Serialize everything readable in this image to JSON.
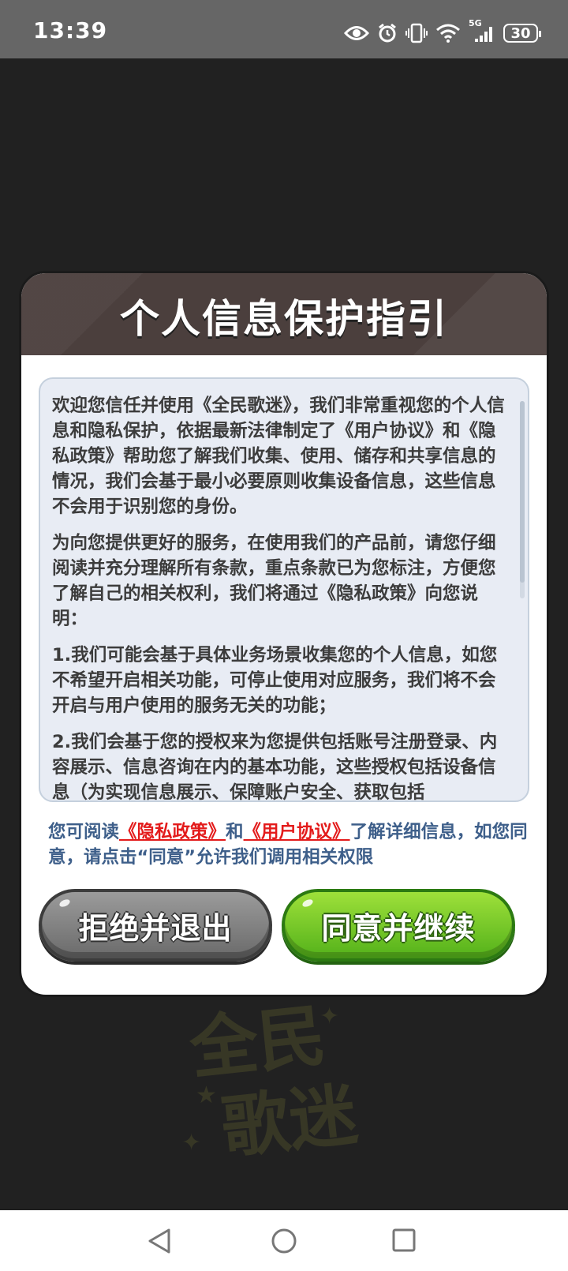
{
  "status_bar": {
    "time": "13:39",
    "battery_level": "30",
    "network_label": "5G",
    "icons": [
      "eye-icon",
      "alarm-icon",
      "vibrate-icon",
      "wifi-icon",
      "signal-icon",
      "battery-icon"
    ]
  },
  "background": {
    "logo_line1": "全民",
    "logo_line2": "歌迷"
  },
  "dialog": {
    "title": "个人信息保护指引",
    "paragraphs": [
      "欢迎您信任并使用《全民歌迷》，我们非常重视您的个人信息和隐私保护，依据最新法律制定了《用户协议》和《隐私政策》帮助您了解我们收集、使用、储存和共享信息的情况，我们会基于最小必要原则收集设备信息，这些信息不会用于识别您的身份。",
      "为向您提供更好的服务，在使用我们的产品前，请您仔细阅读并充分理解所有条款，重点条款已为您标注，方便您了解自己的相关权利，我们将通过《隐私政策》向您说明：",
      "1.我们可能会基于具体业务场景收集您的个人信息，如您不希望开启相关功能，可停止使用对应服务，我们将不会开启与用户使用的服务无关的功能；",
      "2.我们会基于您的授权来为您提供包括账号注册登录、内容展示、信息咨询在内的基本功能，这些授权包括设备信息（为实现信息展示、保障账户安全、获取包括"
    ],
    "notice_prefix": "您可阅读",
    "privacy_link": "《隐私政策》",
    "notice_and": "和",
    "agreement_link": "《用户协议》",
    "notice_suffix": "了解详细信息，如您同意，请点击“同意”允许我们调用相关权限",
    "reject_button": "拒绝并退出",
    "agree_button": "同意并继续"
  },
  "nav_bar": {
    "back": "back-icon",
    "home": "home-icon",
    "recents": "recents-icon"
  },
  "colors": {
    "header_bg": "#4b3f3d",
    "link": "#e31b1b",
    "notice_text": "#3e5f8a",
    "agree_green": "#53b11a",
    "reject_gray": "#7a7a7a"
  }
}
